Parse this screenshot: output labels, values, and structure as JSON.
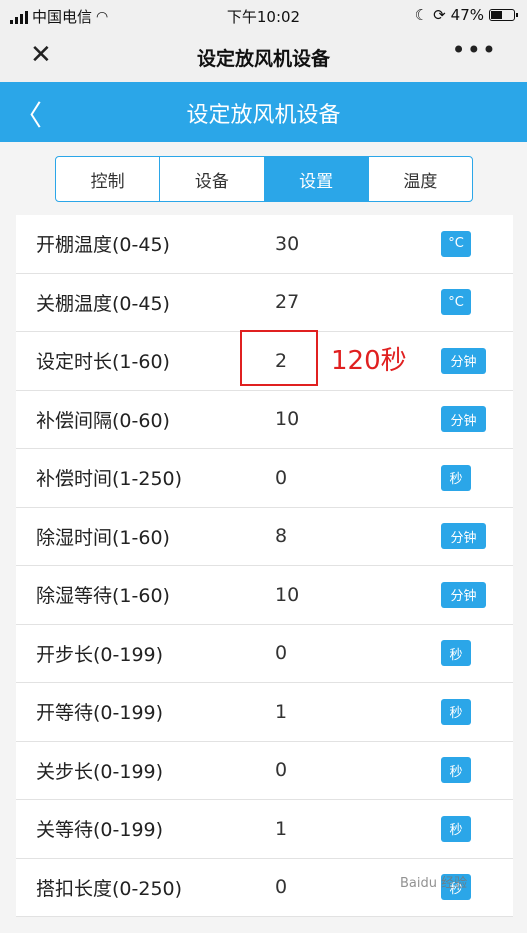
{
  "status_bar": {
    "carrier": "中国电信",
    "time": "下午10:02",
    "battery": "47%"
  },
  "wechat": {
    "title": "设定放风机设备",
    "more": "•••"
  },
  "header": {
    "title": "设定放风机设备"
  },
  "tabs": [
    {
      "label": "控制",
      "active": false
    },
    {
      "label": "设备",
      "active": false
    },
    {
      "label": "设置",
      "active": true
    },
    {
      "label": "温度",
      "active": false
    }
  ],
  "rows": [
    {
      "label": "开棚温度(0-45)",
      "value": "30",
      "unit": "°C"
    },
    {
      "label": "关棚温度(0-45)",
      "value": "27",
      "unit": "°C"
    },
    {
      "label": "设定时长(1-60)",
      "value": "2",
      "unit": "分钟"
    },
    {
      "label": "补偿间隔(0-60)",
      "value": "10",
      "unit": "分钟"
    },
    {
      "label": "补偿时间(1-250)",
      "value": "0",
      "unit": "秒"
    },
    {
      "label": "除湿时间(1-60)",
      "value": "8",
      "unit": "分钟"
    },
    {
      "label": "除湿等待(1-60)",
      "value": "10",
      "unit": "分钟"
    },
    {
      "label": "开步长(0-199)",
      "value": "0",
      "unit": "秒"
    },
    {
      "label": "开等待(0-199)",
      "value": "1",
      "unit": "秒"
    },
    {
      "label": "关步长(0-199)",
      "value": "0",
      "unit": "秒"
    },
    {
      "label": "关等待(0-199)",
      "value": "1",
      "unit": "秒"
    },
    {
      "label": "搭扣长度(0-250)",
      "value": "0",
      "unit": "秒"
    }
  ],
  "annotation": "120秒",
  "watermark": "Baidu 经验"
}
